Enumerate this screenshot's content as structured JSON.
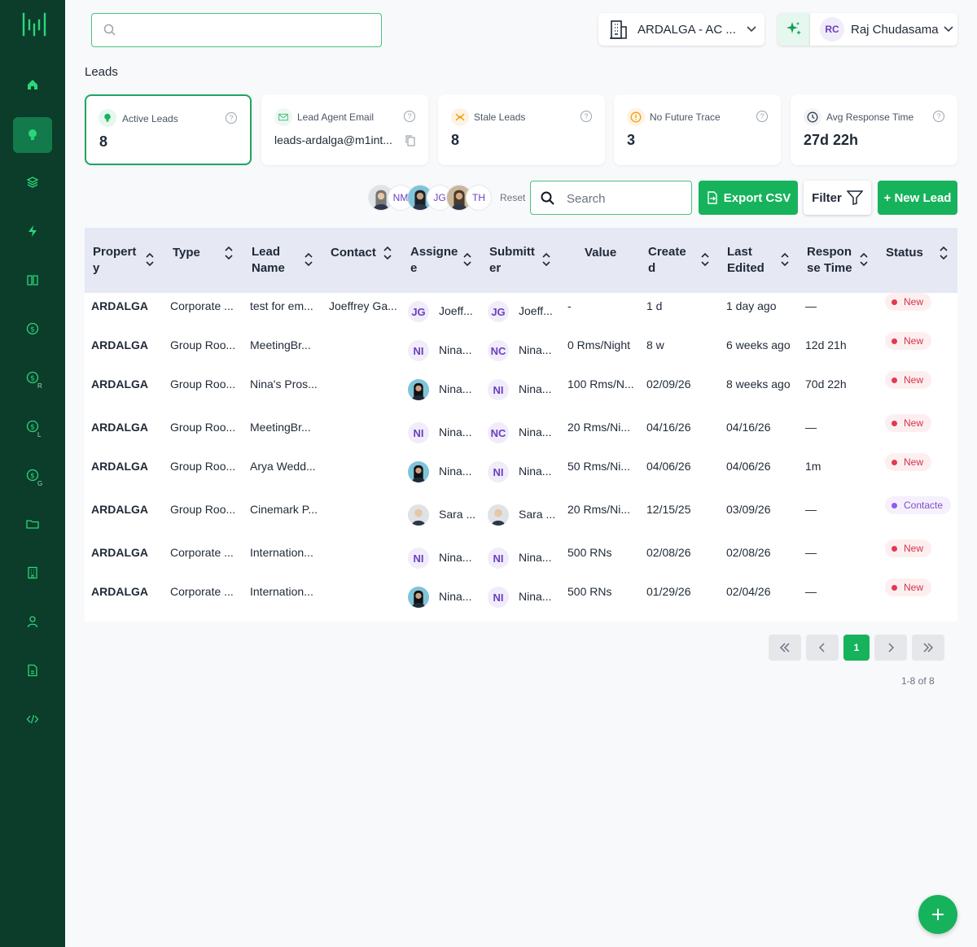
{
  "sidebar": {
    "items": [
      {
        "name": "home-icon"
      },
      {
        "name": "lightbulb-icon",
        "active": true
      },
      {
        "name": "layers-icon"
      },
      {
        "name": "bolt-icon"
      },
      {
        "name": "book-icon"
      },
      {
        "name": "dollar-icon"
      },
      {
        "name": "dollar-r-icon",
        "sub": "R"
      },
      {
        "name": "dollar-l-icon",
        "sub": "L"
      },
      {
        "name": "dollar-g-icon",
        "sub": "G"
      },
      {
        "name": "folder-icon"
      },
      {
        "name": "building-icon"
      },
      {
        "name": "user-icon"
      },
      {
        "name": "document-icon"
      },
      {
        "name": "code-icon"
      }
    ]
  },
  "header": {
    "search_placeholder": "",
    "property_label": "ARDALGA - AC ...",
    "user_initials": "RC",
    "user_name": "Raj Chudasama"
  },
  "page_title": "Leads",
  "stats": [
    {
      "label": "Active Leads",
      "value": "8",
      "icon": "lightbulb-icon",
      "color": "#17b35c"
    },
    {
      "label": "Lead Agent Email",
      "value": "leads-ardalga@m1int...",
      "icon": "mail-icon",
      "color": "#4ac27d"
    },
    {
      "label": "Stale Leads",
      "value": "8",
      "icon": "stale-icon",
      "color": "#f59e0b"
    },
    {
      "label": "No Future Trace",
      "value": "3",
      "icon": "alert-icon",
      "color": "#f59e0b"
    },
    {
      "label": "Avg Response Time",
      "value": "27d 22h",
      "icon": "clock-icon",
      "color": "#374151"
    }
  ],
  "toolbar": {
    "avatars": [
      {
        "kind": "photo"
      },
      {
        "kind": "initials",
        "text": "NM"
      },
      {
        "kind": "photo2"
      },
      {
        "kind": "initials",
        "text": "JG"
      },
      {
        "kind": "photo3"
      },
      {
        "kind": "initials",
        "text": "TH"
      }
    ],
    "reset_label": "Reset",
    "search_placeholder": "Search",
    "export_label": "Export CSV",
    "filter_label": "Filter",
    "new_lead_label": "+ New Lead"
  },
  "table": {
    "columns": [
      {
        "line1": "Propert",
        "line2": "y"
      },
      {
        "line1": "Type",
        "line2": ""
      },
      {
        "line1": "Lead",
        "line2": "Name"
      },
      {
        "line1": "Contact",
        "line2": ""
      },
      {
        "line1": "Assigne",
        "line2": "e"
      },
      {
        "line1": "Submitt",
        "line2": "er"
      },
      {
        "line1": "Value",
        "line2": ""
      },
      {
        "line1": "Create",
        "line2": "d"
      },
      {
        "line1": "Last",
        "line2": "Edited"
      },
      {
        "line1": "Respon",
        "line2": "se Time"
      },
      {
        "line1": "Status",
        "line2": ""
      }
    ],
    "rows": [
      {
        "property": "ARDALGA",
        "type": "Corporate ...",
        "lead_name": "test for em...",
        "contact": "Joeffrey Ga...",
        "assignee": {
          "av": "JG",
          "name": "Joeff..."
        },
        "submitter": {
          "av": "JG",
          "name": "Joeff..."
        },
        "value": "-",
        "created": "1 d",
        "last_edited": "1 day ago",
        "response": "—",
        "status": "New",
        "status_kind": "new"
      },
      {
        "property": "ARDALGA",
        "type": "Group Roo...",
        "lead_name": "MeetingBr...",
        "contact": "",
        "assignee": {
          "av": "NI",
          "name": "Nina..."
        },
        "submitter": {
          "av": "NC",
          "name": "Nina..."
        },
        "value": "0 Rms/Night",
        "created": "8 w",
        "last_edited": "6 weeks ago",
        "response": "12d 21h",
        "status": "New",
        "status_kind": "new"
      },
      {
        "property": "ARDALGA",
        "type": "Group Roo...",
        "lead_name": "Nina's Pros...",
        "contact": "",
        "assignee": {
          "av": "",
          "photo": true,
          "name": "Nina..."
        },
        "submitter": {
          "av": "NI",
          "name": "Nina..."
        },
        "value": "100 Rms/N...",
        "created": "02/09/26",
        "last_edited": "8 weeks ago",
        "response": "70d 22h",
        "status": "New",
        "status_kind": "new"
      },
      {
        "property": "ARDALGA",
        "type": "Group Roo...",
        "lead_name": "MeetingBr...",
        "contact": "",
        "assignee": {
          "av": "NI",
          "name": "Nina..."
        },
        "submitter": {
          "av": "NC",
          "name": "Nina..."
        },
        "value": "20 Rms/Ni...",
        "created": "04/16/26",
        "last_edited": "04/16/26",
        "response": "—",
        "status": "New",
        "status_kind": "new"
      },
      {
        "property": "ARDALGA",
        "type": "Group Roo...",
        "lead_name": "Arya Wedd...",
        "contact": "",
        "assignee": {
          "av": "",
          "photo": true,
          "name": "Nina..."
        },
        "submitter": {
          "av": "NI",
          "name": "Nina..."
        },
        "value": "50 Rms/Ni...",
        "created": "04/06/26",
        "last_edited": "04/06/26",
        "response": "1m",
        "status": "New",
        "status_kind": "new"
      },
      {
        "property": "ARDALGA",
        "type": "Group Roo...",
        "lead_name": "Cinemark P...",
        "contact": "",
        "assignee": {
          "av": "",
          "photo": true,
          "name": "Sara ..."
        },
        "submitter": {
          "av": "",
          "photo": true,
          "name": "Sara ..."
        },
        "value": "20 Rms/Ni...",
        "created": "12/15/25",
        "last_edited": "03/09/26",
        "response": "—",
        "status": "Contacte",
        "status_kind": "contacted"
      },
      {
        "property": "ARDALGA",
        "type": "Corporate ...",
        "lead_name": "Internation...",
        "contact": "",
        "assignee": {
          "av": "NI",
          "name": "Nina..."
        },
        "submitter": {
          "av": "NI",
          "name": "Nina..."
        },
        "value": "500 RNs",
        "created": "02/08/26",
        "last_edited": "02/08/26",
        "response": "—",
        "status": "New",
        "status_kind": "new"
      },
      {
        "property": "ARDALGA",
        "type": "Corporate ...",
        "lead_name": "Internation...",
        "contact": "",
        "assignee": {
          "av": "",
          "photo": true,
          "name": "Nina..."
        },
        "submitter": {
          "av": "NI",
          "name": "Nina..."
        },
        "value": "500 RNs",
        "created": "01/29/26",
        "last_edited": "02/04/26",
        "response": "—",
        "status": "New",
        "status_kind": "new"
      }
    ]
  },
  "pagination": {
    "current_page": "1",
    "summary": "1-8 of 8"
  },
  "colors": {
    "sidebar_bg": "#0b3d2a",
    "accent": "#17b35c",
    "new_status": "#e03a52",
    "contacted_status": "#8b5cf6"
  }
}
